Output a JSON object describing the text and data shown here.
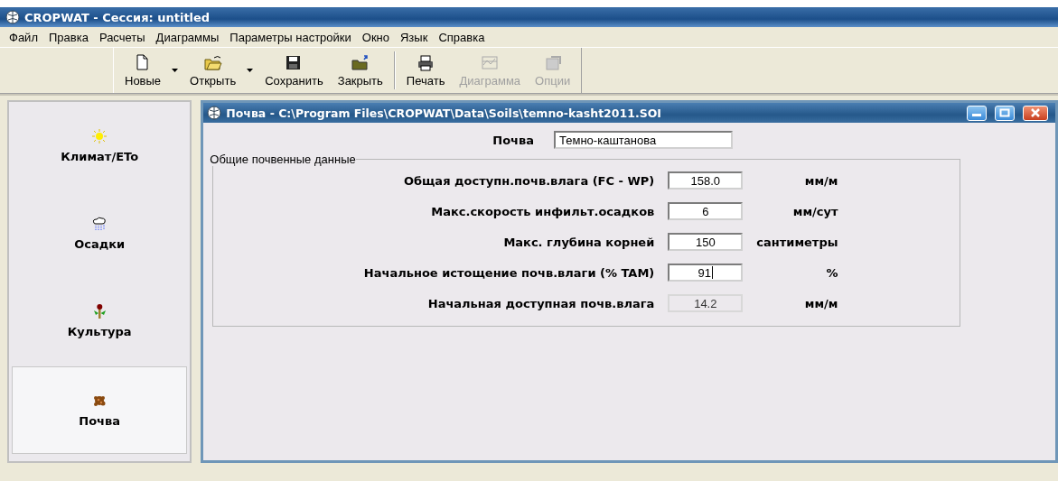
{
  "window": {
    "title": "CROPWAT - Сессия: untitled"
  },
  "menu": [
    "Файл",
    "Правка",
    "Расчеты",
    "Диаграммы",
    "Параметры настройки",
    "Окно",
    "Язык",
    "Справка"
  ],
  "toolbar": [
    {
      "label": "Новые",
      "disabled": false,
      "dropdown": true,
      "separator_after": false
    },
    {
      "label": "Открыть",
      "disabled": false,
      "dropdown": true,
      "separator_after": false
    },
    {
      "label": "Сохранить",
      "disabled": false,
      "dropdown": false,
      "separator_after": false
    },
    {
      "label": "Закрыть",
      "disabled": false,
      "dropdown": false,
      "separator_after": true
    },
    {
      "label": "Печать",
      "disabled": false,
      "dropdown": false,
      "separator_after": false
    },
    {
      "label": "Диаграмма",
      "disabled": true,
      "dropdown": false,
      "separator_after": false
    },
    {
      "label": "Опции",
      "disabled": true,
      "dropdown": false,
      "separator_after": false
    }
  ],
  "sidebar": {
    "items": [
      {
        "label": "Климат/ETo",
        "selected": false
      },
      {
        "label": "Осадки",
        "selected": false
      },
      {
        "label": "Культура",
        "selected": false
      },
      {
        "label": "Почва",
        "selected": true
      }
    ]
  },
  "child_window": {
    "title": "Почва - C:\\Program Files\\CROPWAT\\Data\\Soils\\temno-kasht2011.SOI",
    "soil": {
      "label": "Почва",
      "value": "Темно-каштанова"
    },
    "group": {
      "title": "Общие почвенные данные",
      "rows": [
        {
          "label": "Общая доступн.почв.влага (FC - WP)",
          "value": "158.0",
          "unit": "мм/м",
          "disabled": false,
          "focused": false
        },
        {
          "label": "Макс.скорость инфильт.осадков",
          "value": "6",
          "unit": "мм/сут",
          "disabled": false,
          "focused": false
        },
        {
          "label": "Макс. глубина корней",
          "value": "150",
          "unit": "сантиметры",
          "disabled": false,
          "focused": false
        },
        {
          "label": "Начальное истощение почв.влаги (% TAM)",
          "value": "91",
          "unit": "%",
          "disabled": false,
          "focused": true
        },
        {
          "label": "Начальная доступная почв.влага",
          "value": "14.2",
          "unit": "мм/м",
          "disabled": true,
          "focused": false
        }
      ]
    }
  }
}
